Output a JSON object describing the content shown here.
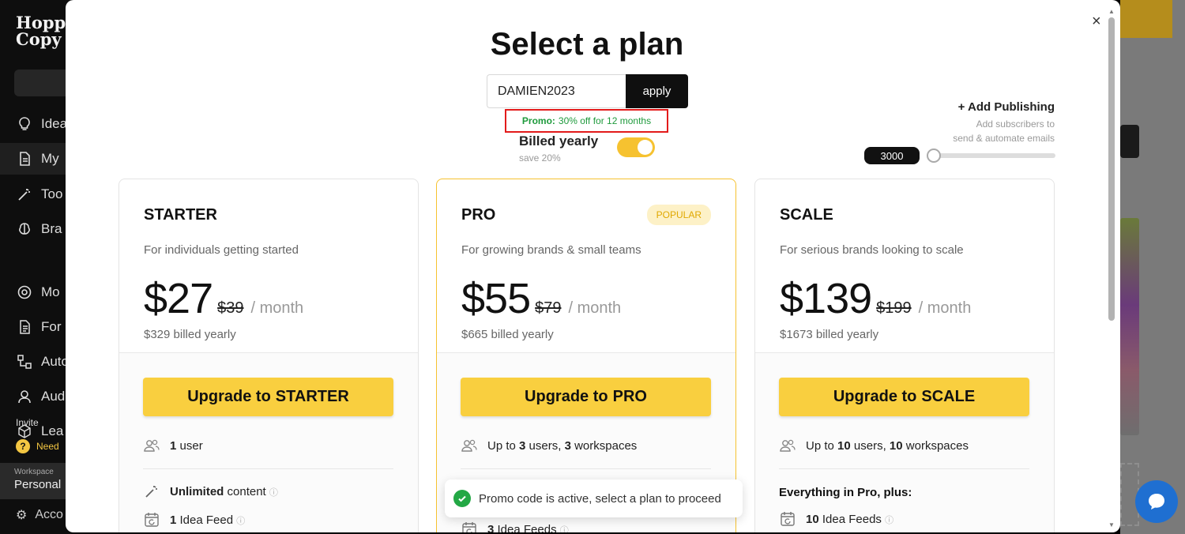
{
  "background_app": {
    "logo_line1": "Hopp",
    "logo_line2": "Copy",
    "nav": [
      "Idea",
      "My",
      "Too",
      "Bra",
      "Mo",
      "For",
      "Auto",
      "Aud",
      "Lea"
    ],
    "invite_label": "Invite",
    "help_label": "Need",
    "workspace_label": "Workspace",
    "workspace_value": "Personal",
    "account_label": "Acco"
  },
  "modal": {
    "title": "Select a plan",
    "promo_code_value": "DAMIEN2023",
    "apply_label": "apply",
    "promo_note_bold": "Promo:",
    "promo_note_text": "30% off for 12 months",
    "billing_label": "Billed yearly",
    "billing_save": "save 20%",
    "addon_title": "+ Add Publishing",
    "addon_sub_line1": "Add subscribers to",
    "addon_sub_line2": "send & automate emails",
    "slider_value": "3000",
    "close_icon": "×"
  },
  "plans": [
    {
      "name": "STARTER",
      "badge": "",
      "description": "For individuals getting started",
      "price": "$27",
      "old_price": "$39",
      "per": "/ month",
      "yearly": "$329 billed yearly",
      "button_prefix": "Upgrade to",
      "button_plan": "STARTER",
      "f1_a": "1",
      "f1_b": "user",
      "f2_a": "Unlimited",
      "f2_b": "content",
      "f3_a": "1",
      "f3_b": "Idea Feed"
    },
    {
      "name": "PRO",
      "badge": "POPULAR",
      "description": "For growing brands & small teams",
      "price": "$55",
      "old_price": "$79",
      "per": "/ month",
      "yearly": "$665 billed yearly",
      "button_prefix": "Upgrade to",
      "button_plan": "PRO",
      "f1_pre": "Up to",
      "f1_n1": "3",
      "f1_mid": "users,",
      "f1_n2": "3",
      "f1_post": "workspaces",
      "f3_a": "3",
      "f3_b": "Idea Feeds"
    },
    {
      "name": "SCALE",
      "badge": "",
      "description": "For serious brands looking to scale",
      "price": "$139",
      "old_price": "$199",
      "per": "/ month",
      "yearly": "$1673 billed yearly",
      "button_prefix": "Upgrade to",
      "button_plan": "SCALE",
      "f1_pre": "Up to",
      "f1_n1": "10",
      "f1_mid": "users,",
      "f1_n2": "10",
      "f1_post": "workspaces",
      "plus_title": "Everything in Pro, plus:",
      "f3_a": "10",
      "f3_b": "Idea Feeds"
    }
  ],
  "toast": {
    "message": "Promo code is active, select a plan to proceed"
  },
  "colors": {
    "accent_yellow": "#f9cf3f",
    "promo_green": "#1e9a3c",
    "highlight_red": "#e31b1b",
    "toast_green": "#23a845"
  }
}
